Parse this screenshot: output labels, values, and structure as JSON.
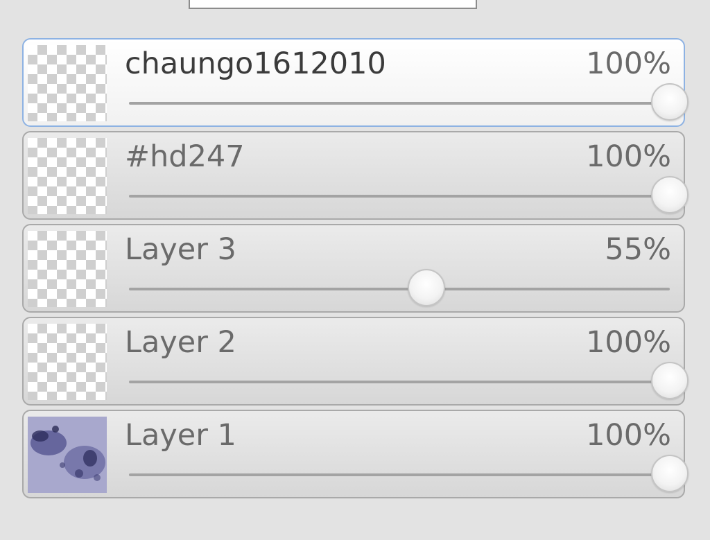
{
  "layers_panel": {
    "layers": [
      {
        "name": "chaungo1612010",
        "opacity_label": "100%",
        "opacity": 100,
        "selected": true,
        "thumbnail": "transparent-checker"
      },
      {
        "name": "#hd247",
        "opacity_label": "100%",
        "opacity": 100,
        "selected": false,
        "thumbnail": "transparent-checker"
      },
      {
        "name": "Layer 3",
        "opacity_label": "55%",
        "opacity": 55,
        "selected": false,
        "thumbnail": "transparent-checker"
      },
      {
        "name": "Layer 2",
        "opacity_label": "100%",
        "opacity": 100,
        "selected": false,
        "thumbnail": "transparent-checker"
      },
      {
        "name": "Layer 1",
        "opacity_label": "100%",
        "opacity": 100,
        "selected": false,
        "thumbnail": "purple-texture-image"
      }
    ]
  },
  "colors": {
    "selected_border": "#8db2e3",
    "row_border": "#a9a9a9",
    "panel_background": "#e3e3e3",
    "thumbnail_purple": "#8f8fbf"
  }
}
